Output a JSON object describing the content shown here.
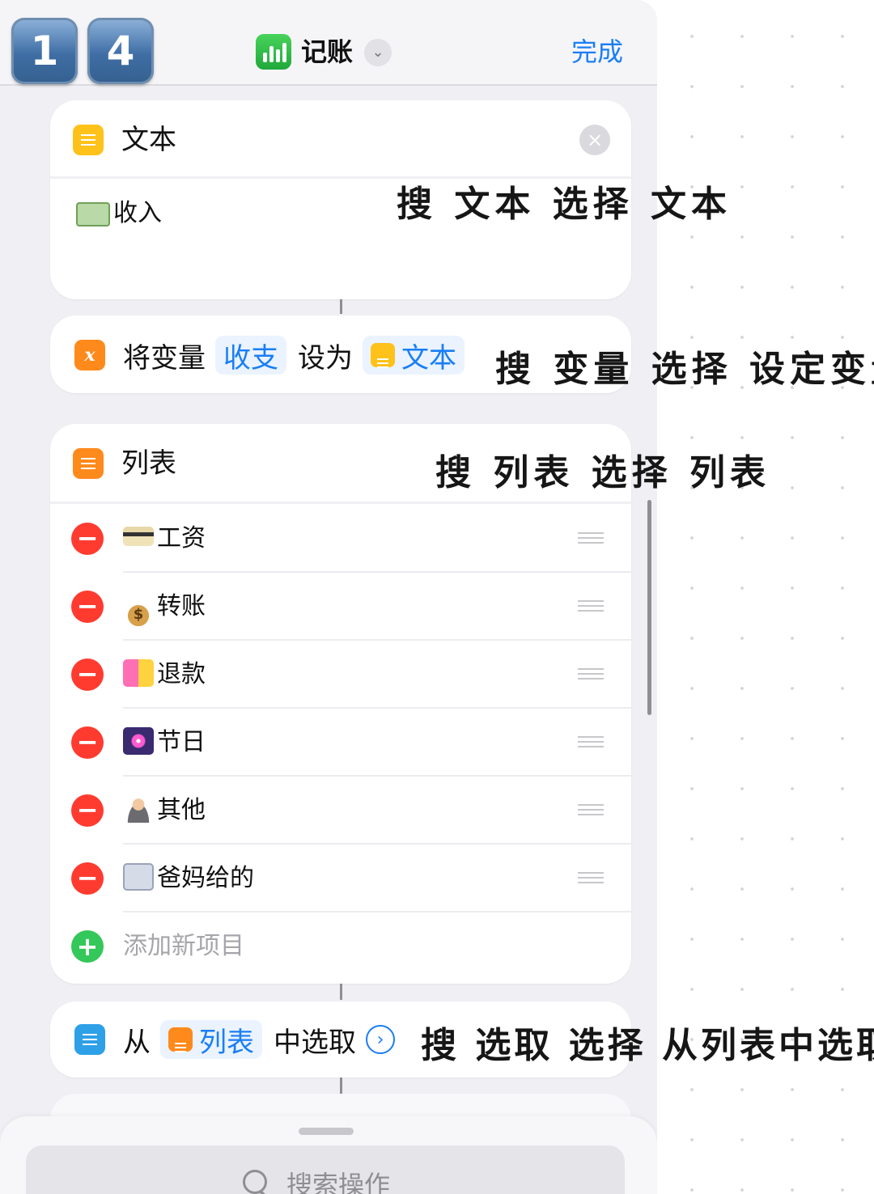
{
  "header": {
    "keycap_1": "1",
    "keycap_2": "4",
    "shortcut_name": "记账",
    "done_label": "完成"
  },
  "text_action": {
    "title": "文本",
    "content": "收入"
  },
  "set_variable": {
    "prefix": "将变量",
    "variable_name": "收支",
    "middle": "设为",
    "value_token": "文本"
  },
  "list_action": {
    "title": "列表",
    "items": [
      {
        "label": "工资",
        "emoji": "credit-card"
      },
      {
        "label": "转账",
        "emoji": "money-bag"
      },
      {
        "label": "退款",
        "emoji": "shopping-bags"
      },
      {
        "label": "节日",
        "emoji": "fireworks"
      },
      {
        "label": "其他",
        "emoji": "person"
      },
      {
        "label": "爸妈给的",
        "emoji": "family"
      }
    ],
    "add_item_label": "添加新项目"
  },
  "choose_action": {
    "prefix": "从",
    "list_token": "列表",
    "suffix": "中选取"
  },
  "search": {
    "placeholder": "搜索操作"
  },
  "annotations": {
    "text_tip": "搜 文本 选择 文本",
    "variable_tip": "搜 变量 选择 设定变量",
    "list_tip": "搜 列表 选择 列表",
    "choose_tip": "搜 选取 选择 从列表中选取"
  },
  "colors": {
    "accent": "#1a7ef5",
    "text_icon": "#ffc21a",
    "variable_icon": "#ff8a1c",
    "delete": "#ff3b30",
    "add": "#34c759"
  }
}
